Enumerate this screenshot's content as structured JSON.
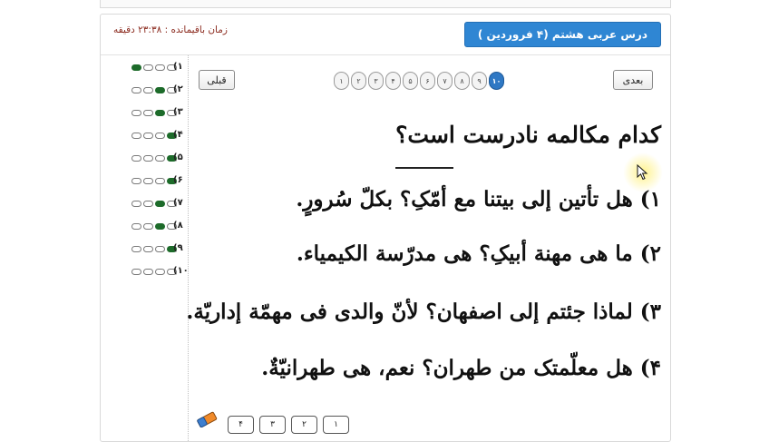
{
  "header": {
    "title": "درس عربی هشتم (۴ فروردین )",
    "timer": "زمان باقیمانده : ۲۳:۳۸ دقیقه"
  },
  "answer_sheet": [
    {
      "num": "۱)",
      "selected": 1
    },
    {
      "num": "۲)",
      "selected": 3
    },
    {
      "num": "۳)",
      "selected": 3
    },
    {
      "num": "۴)",
      "selected": 4
    },
    {
      "num": "۵)",
      "selected": 4
    },
    {
      "num": "۶)",
      "selected": 4
    },
    {
      "num": "۷)",
      "selected": 3
    },
    {
      "num": "۸)",
      "selected": 3
    },
    {
      "num": "۹)",
      "selected": 4
    },
    {
      "num": "۱۰)",
      "selected": 0
    }
  ],
  "nav": {
    "next_label": "بعدی",
    "prev_label": "قبلی"
  },
  "pager": {
    "pages": [
      "۱",
      "۲",
      "۳",
      "۴",
      "۵",
      "۶",
      "۷",
      "۸",
      "۹",
      "۱۰"
    ],
    "current": "۱۰"
  },
  "question": {
    "stem": "کدام مکالمه نادرست است؟",
    "options": [
      "۱) هل تأتین إلی بیتنا مع أمّکِ؟ بکلّ سُرورٍ.",
      "۲) ما هی مهنة أبیکِ؟ هی مدرّسة الکیمیاء.",
      "۳) لماذا جئتم إلی اصفهان؟ لأنّ والدی فی مهمّة إداریّة.",
      "۴) هل معلّمتک من طهران؟ نعم، هی طهرانیّةٌ."
    ]
  },
  "choices": [
    "۱",
    "۲",
    "۳",
    "۴"
  ],
  "colors": {
    "accent": "#2f86d3",
    "timer": "#8b2a1e",
    "selected_bubble": "#1d6b2a"
  },
  "icons": {
    "eraser": "eraser-icon",
    "cursor": "mouse-pointer-icon"
  }
}
